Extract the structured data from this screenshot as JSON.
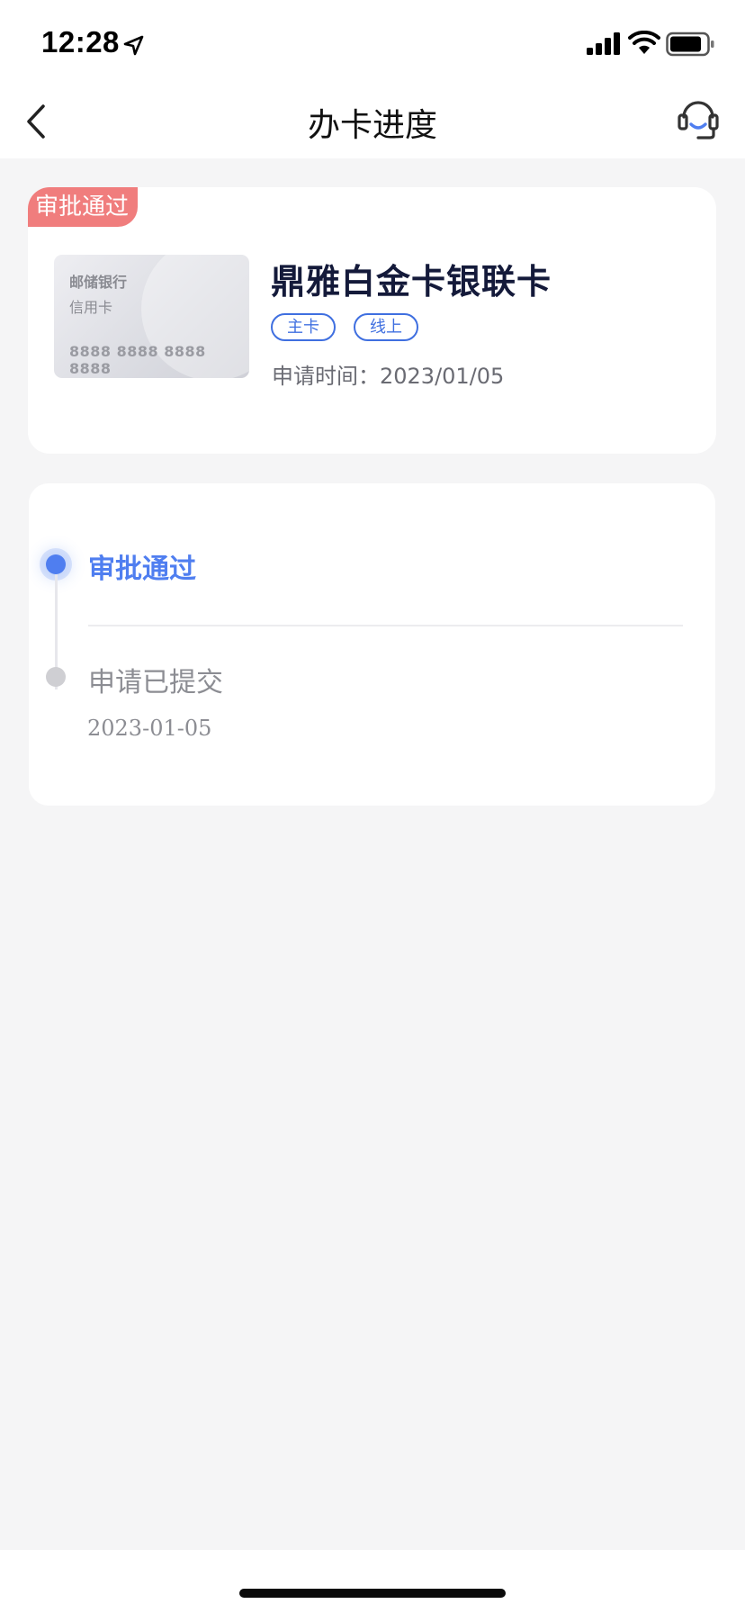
{
  "status_bar": {
    "time": "12:28",
    "icons": [
      "location-arrow-icon",
      "signal-icon",
      "wifi-icon",
      "battery-icon"
    ]
  },
  "nav": {
    "title": "办卡进度",
    "left_icon": "back-chevron-icon",
    "right_icon": "customer-service-headset-icon"
  },
  "card": {
    "badge": "审批通过",
    "image": {
      "bank": "邮储银行",
      "type": "信用卡",
      "number": "8888 8888 8888 8888"
    },
    "name": "鼎雅白金卡银联卡",
    "tags": [
      "主卡",
      "线上"
    ],
    "apply_time": "申请时间：2023/01/05"
  },
  "progress": {
    "steps": [
      {
        "label": "审批通过",
        "status": "current"
      },
      {
        "label": "申请已提交",
        "date": "2023-01-05",
        "status": "done"
      }
    ]
  },
  "colors": {
    "accent": "#4f7ef0",
    "badge": "#f07d7d",
    "background": "#f5f5f6",
    "title": "#141a3a"
  }
}
